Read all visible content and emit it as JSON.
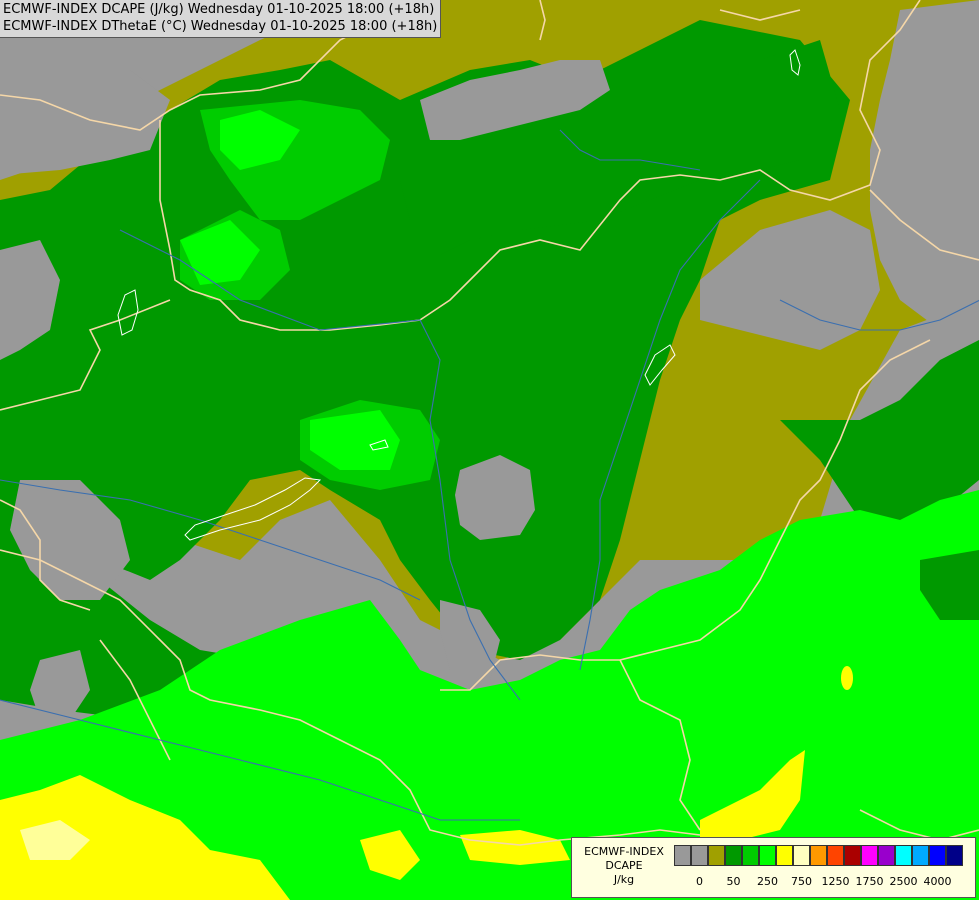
{
  "header": {
    "line1": "ECMWF-INDEX DCAPE (J/kg) Wednesday 01-10-2025 18:00 (+18h)",
    "line2": "ECMWF-INDEX DThetaE (°C) Wednesday 01-10-2025 18:00 (+18h)"
  },
  "legend": {
    "title_line1": "ECMWF-INDEX",
    "title_line2": "DCAPE",
    "title_line3": "J/kg",
    "colors": [
      "#999999",
      "#999999",
      "#a0a000",
      "#009900",
      "#00cc00",
      "#00ff00",
      "#ffff00",
      "#ffffc0",
      "#ff9900",
      "#ff4400",
      "#aa0000",
      "#ff00ff",
      "#9900cc",
      "#00ffff",
      "#00aaff",
      "#0000ff",
      "#000088"
    ],
    "tick_labels": [
      "0",
      "50",
      "250",
      "750",
      "1250",
      "1750",
      "2500",
      "4000"
    ]
  },
  "map_colors": {
    "gray": "#999999",
    "olive": "#a0a000",
    "dark_green": "#009900",
    "green": "#00cc00",
    "bright_green": "#00ff00",
    "yellow": "#ffff00",
    "pale_yellow": "#ffff99",
    "border": "#f5d7a8",
    "river": "#3a6fb0"
  }
}
